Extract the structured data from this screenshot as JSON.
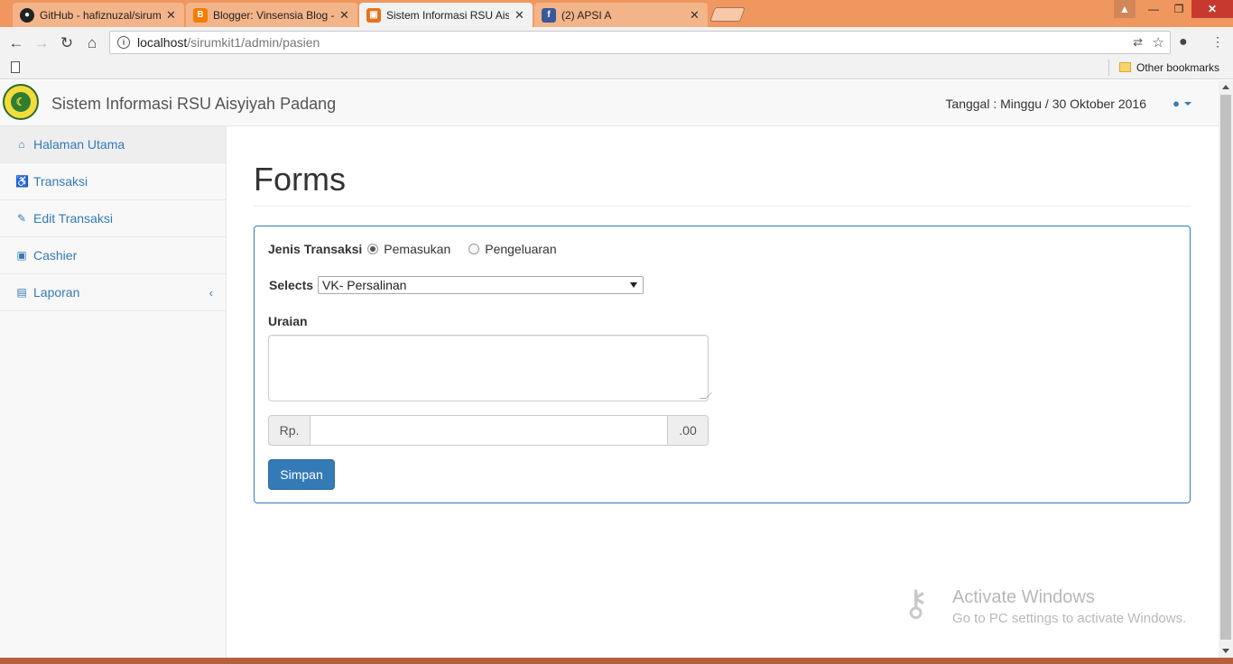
{
  "browser": {
    "tabs": [
      {
        "title": "GitHub - hafiznuzal/sirum",
        "favicon": "github-icon",
        "active": false
      },
      {
        "title": "Blogger: Vinsensia Blog -",
        "favicon": "blogger-icon",
        "active": false
      },
      {
        "title": "Sistem Informasi RSU Ais",
        "favicon": "site-icon",
        "active": true
      },
      {
        "title": "(2) APSI A",
        "favicon": "facebook-icon",
        "active": false
      }
    ],
    "url_host": "localhost",
    "url_path": "/sirumkit1/admin/pasien",
    "bookmarks_folder": "Other bookmarks"
  },
  "navbar": {
    "brand": "Sistem Informasi RSU Aisyiyah Padang",
    "date": "Tanggal : Minggu / 30 Oktober 2016"
  },
  "sidebar": {
    "items": [
      {
        "label": "Halaman Utama",
        "icon": "home-icon",
        "glyph": "⌂"
      },
      {
        "label": "Transaksi",
        "icon": "wheelchair-icon",
        "glyph": "♿"
      },
      {
        "label": "Edit Transaksi",
        "icon": "edit-icon",
        "glyph": "✎"
      },
      {
        "label": "Cashier",
        "icon": "money-icon",
        "glyph": "▣"
      },
      {
        "label": "Laporan",
        "icon": "file-icon",
        "glyph": "▤"
      }
    ]
  },
  "main": {
    "title": "Forms",
    "form": {
      "jenis_label": "Jenis Transaksi",
      "option_in": "Pemasukan",
      "option_out": "Pengeluaran",
      "selected_option": "Pemasukan",
      "selects_label": "Selects",
      "selects_value": "VK- Persalinan",
      "uraian_label": "Uraian",
      "uraian_value": "",
      "currency_prefix": "Rp.",
      "currency_suffix": ".00",
      "amount_value": "",
      "submit_label": "Simpan"
    }
  },
  "watermark": {
    "title": "Activate Windows",
    "subtitle": "Go to PC settings to activate Windows."
  },
  "colors": {
    "accent": "#337ab7",
    "titlebar": "#f0975f"
  }
}
